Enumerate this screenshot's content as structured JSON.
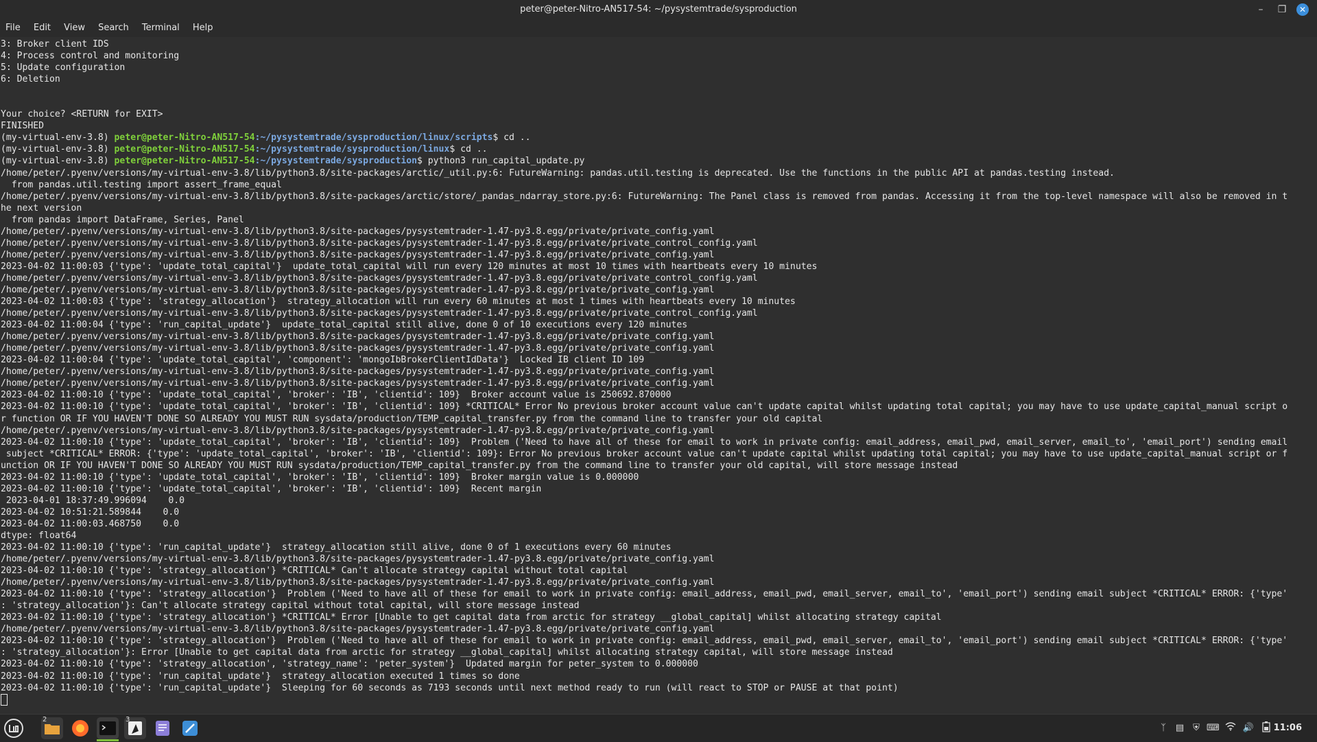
{
  "window": {
    "title": "peter@peter-Nitro-AN517-54: ~/pysystemtrade/sysproduction"
  },
  "menu": [
    "File",
    "Edit",
    "View",
    "Search",
    "Terminal",
    "Help"
  ],
  "terminal": {
    "lines": [
      {
        "t": "3: Broker client IDS"
      },
      {
        "t": "4: Process control and monitoring"
      },
      {
        "t": "5: Update configuration"
      },
      {
        "t": "6: Deletion"
      },
      {
        "t": ""
      },
      {
        "t": ""
      },
      {
        "t": "Your choice? <RETURN for EXIT>"
      },
      {
        "t": "FINISHED"
      },
      {
        "env": "(my-virtual-env-3.8) ",
        "user": "peter@peter-Nitro-AN517-54",
        "path": ":~/pysystemtrade/sysproduction/linux/scripts",
        "cmd": "$ cd .."
      },
      {
        "env": "(my-virtual-env-3.8) ",
        "user": "peter@peter-Nitro-AN517-54",
        "path": ":~/pysystemtrade/sysproduction/linux",
        "cmd": "$ cd .."
      },
      {
        "env": "(my-virtual-env-3.8) ",
        "user": "peter@peter-Nitro-AN517-54",
        "path": ":~/pysystemtrade/sysproduction",
        "cmd": "$ python3 run_capital_update.py"
      },
      {
        "t": "/home/peter/.pyenv/versions/my-virtual-env-3.8/lib/python3.8/site-packages/arctic/_util.py:6: FutureWarning: pandas.util.testing is deprecated. Use the functions in the public API at pandas.testing instead."
      },
      {
        "t": "  from pandas.util.testing import assert_frame_equal"
      },
      {
        "t": "/home/peter/.pyenv/versions/my-virtual-env-3.8/lib/python3.8/site-packages/arctic/store/_pandas_ndarray_store.py:6: FutureWarning: The Panel class is removed from pandas. Accessing it from the top-level namespace will also be removed in t"
      },
      {
        "t": "he next version"
      },
      {
        "t": "  from pandas import DataFrame, Series, Panel"
      },
      {
        "t": "/home/peter/.pyenv/versions/my-virtual-env-3.8/lib/python3.8/site-packages/pysystemtrader-1.47-py3.8.egg/private/private_config.yaml"
      },
      {
        "t": "/home/peter/.pyenv/versions/my-virtual-env-3.8/lib/python3.8/site-packages/pysystemtrader-1.47-py3.8.egg/private/private_control_config.yaml"
      },
      {
        "t": "/home/peter/.pyenv/versions/my-virtual-env-3.8/lib/python3.8/site-packages/pysystemtrader-1.47-py3.8.egg/private/private_config.yaml"
      },
      {
        "t": "2023-04-02 11:00:03 {'type': 'update_total_capital'}  update_total_capital will run every 120 minutes at most 10 times with heartbeats every 10 minutes"
      },
      {
        "t": "/home/peter/.pyenv/versions/my-virtual-env-3.8/lib/python3.8/site-packages/pysystemtrader-1.47-py3.8.egg/private/private_control_config.yaml"
      },
      {
        "t": "/home/peter/.pyenv/versions/my-virtual-env-3.8/lib/python3.8/site-packages/pysystemtrader-1.47-py3.8.egg/private/private_config.yaml"
      },
      {
        "t": "2023-04-02 11:00:03 {'type': 'strategy_allocation'}  strategy_allocation will run every 60 minutes at most 1 times with heartbeats every 10 minutes"
      },
      {
        "t": "/home/peter/.pyenv/versions/my-virtual-env-3.8/lib/python3.8/site-packages/pysystemtrader-1.47-py3.8.egg/private/private_control_config.yaml"
      },
      {
        "t": "2023-04-02 11:00:04 {'type': 'run_capital_update'}  update_total_capital still alive, done 0 of 10 executions every 120 minutes"
      },
      {
        "t": "/home/peter/.pyenv/versions/my-virtual-env-3.8/lib/python3.8/site-packages/pysystemtrader-1.47-py3.8.egg/private/private_config.yaml"
      },
      {
        "t": "/home/peter/.pyenv/versions/my-virtual-env-3.8/lib/python3.8/site-packages/pysystemtrader-1.47-py3.8.egg/private/private_config.yaml"
      },
      {
        "t": "2023-04-02 11:00:04 {'type': 'update_total_capital', 'component': 'mongoIbBrokerClientIdData'}  Locked IB client ID 109"
      },
      {
        "t": "/home/peter/.pyenv/versions/my-virtual-env-3.8/lib/python3.8/site-packages/pysystemtrader-1.47-py3.8.egg/private/private_config.yaml"
      },
      {
        "t": "/home/peter/.pyenv/versions/my-virtual-env-3.8/lib/python3.8/site-packages/pysystemtrader-1.47-py3.8.egg/private/private_config.yaml"
      },
      {
        "t": "2023-04-02 11:00:10 {'type': 'update_total_capital', 'broker': 'IB', 'clientid': 109}  Broker account value is 250692.870000"
      },
      {
        "t": "2023-04-02 11:00:10 {'type': 'update_total_capital', 'broker': 'IB', 'clientid': 109} *CRITICAL* Error No previous broker account value can't update capital whilst updating total capital; you may have to use update_capital_manual script o"
      },
      {
        "t": "r function OR IF YOU HAVEN'T DONE SO ALREADY YOU MUST RUN sysdata/production/TEMP_capital_transfer.py from the command line to transfer your old capital"
      },
      {
        "t": "/home/peter/.pyenv/versions/my-virtual-env-3.8/lib/python3.8/site-packages/pysystemtrader-1.47-py3.8.egg/private/private_config.yaml"
      },
      {
        "t": "2023-04-02 11:00:10 {'type': 'update_total_capital', 'broker': 'IB', 'clientid': 109}  Problem ('Need to have all of these for email to work in private config: email_address, email_pwd, email_server, email_to', 'email_port') sending email"
      },
      {
        "t": " subject *CRITICAL* ERROR: {'type': 'update_total_capital', 'broker': 'IB', 'clientid': 109}: Error No previous broker account value can't update capital whilst updating total capital; you may have to use update_capital_manual script or f"
      },
      {
        "t": "unction OR IF YOU HAVEN'T DONE SO ALREADY YOU MUST RUN sysdata/production/TEMP_capital_transfer.py from the command line to transfer your old capital, will store message instead"
      },
      {
        "t": "2023-04-02 11:00:10 {'type': 'update_total_capital', 'broker': 'IB', 'clientid': 109}  Broker margin value is 0.000000"
      },
      {
        "t": "2023-04-02 11:00:10 {'type': 'update_total_capital', 'broker': 'IB', 'clientid': 109}  Recent margin"
      },
      {
        "t": " 2023-04-01 18:37:49.996094    0.0"
      },
      {
        "t": "2023-04-02 10:51:21.589844    0.0"
      },
      {
        "t": "2023-04-02 11:00:03.468750    0.0"
      },
      {
        "t": "dtype: float64"
      },
      {
        "t": "2023-04-02 11:00:10 {'type': 'run_capital_update'}  strategy_allocation still alive, done 0 of 1 executions every 60 minutes"
      },
      {
        "t": "/home/peter/.pyenv/versions/my-virtual-env-3.8/lib/python3.8/site-packages/pysystemtrader-1.47-py3.8.egg/private/private_config.yaml"
      },
      {
        "t": "2023-04-02 11:00:10 {'type': 'strategy_allocation'} *CRITICAL* Can't allocate strategy capital without total capital"
      },
      {
        "t": "/home/peter/.pyenv/versions/my-virtual-env-3.8/lib/python3.8/site-packages/pysystemtrader-1.47-py3.8.egg/private/private_config.yaml"
      },
      {
        "t": "2023-04-02 11:00:10 {'type': 'strategy_allocation'}  Problem ('Need to have all of these for email to work in private config: email_address, email_pwd, email_server, email_to', 'email_port') sending email subject *CRITICAL* ERROR: {'type'"
      },
      {
        "t": ": 'strategy_allocation'}: Can't allocate strategy capital without total capital, will store message instead"
      },
      {
        "t": "2023-04-02 11:00:10 {'type': 'strategy_allocation'} *CRITICAL* Error [Unable to get capital data from arctic for strategy __global_capital] whilst allocating strategy capital"
      },
      {
        "t": "/home/peter/.pyenv/versions/my-virtual-env-3.8/lib/python3.8/site-packages/pysystemtrader-1.47-py3.8.egg/private/private_config.yaml"
      },
      {
        "t": "2023-04-02 11:00:10 {'type': 'strategy_allocation'}  Problem ('Need to have all of these for email to work in private config: email_address, email_pwd, email_server, email_to', 'email_port') sending email subject *CRITICAL* ERROR: {'type'"
      },
      {
        "t": ": 'strategy_allocation'}: Error [Unable to get capital data from arctic for strategy __global_capital] whilst allocating strategy capital, will store message instead"
      },
      {
        "t": "2023-04-02 11:00:10 {'type': 'strategy_allocation', 'strategy_name': 'peter_system'}  Updated margin for peter_system to 0.000000"
      },
      {
        "t": "2023-04-02 11:00:10 {'type': 'run_capital_update'}  strategy_allocation executed 1 times so done"
      },
      {
        "t": "2023-04-02 11:00:10 {'type': 'run_capital_update'}  Sleeping for 60 seconds as 7193 seconds until next method ready to run (will react to STOP or PAUSE at that point)"
      }
    ]
  },
  "taskbar": {
    "badges": {
      "files": "2",
      "inkscape": "3"
    },
    "clock": "11:06"
  },
  "colors": {
    "background": "#2f2f2f",
    "text": "#e6e6e6",
    "prompt_user": "#7fd03b",
    "prompt_path": "#7ba8e0",
    "close_button": "#3c8fdc"
  }
}
